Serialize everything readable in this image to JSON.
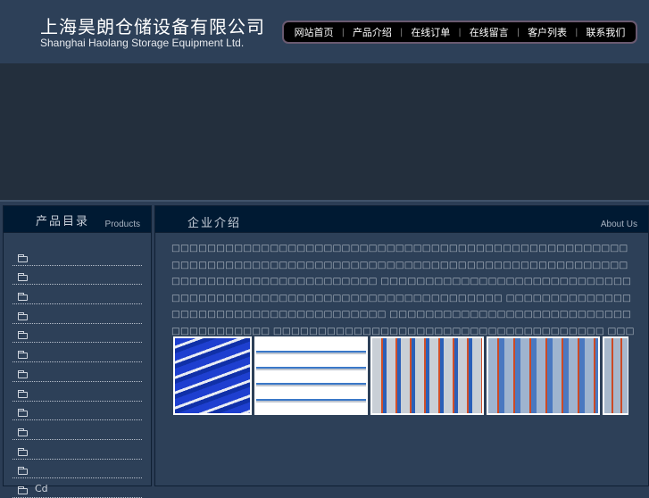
{
  "header": {
    "company_cn": "上海昊朗仓储设备有限公司",
    "company_en": "Shanghai Haolang Storage Equipment Ltd."
  },
  "nav": [
    "网站首页",
    "产品介绍",
    "在线订单",
    "在线留言",
    "客户列表",
    "联系我们"
  ],
  "nav_separator": "|",
  "sidebar": {
    "title": "产品目录",
    "subtitle": "Products",
    "items": [
      "",
      "",
      "",
      "",
      "",
      "",
      "",
      "",
      "",
      "",
      "",
      "",
      "Cd"
    ]
  },
  "main": {
    "title": "企业介绍",
    "subtitle": "About Us",
    "paragraph": "□□□□□□□□□□□□□□□□□□□□□□□□□□□□□□□□□□□□□□□□□□□□□□□□□□□□□□□□□□□□□□□□□□□□□□□□□□□□□□□□□□□□□□□□□□□□□□□□□□□□□□□□□□□□□□□□□□□□□□□□□□□□□ □□□□□□□□□□□□□□□□□□□□□□□□□□□□□□□□□□□□□□□□□□□□□□□□□□□□□□□□□□□□□□□□□ □□□□□□□□□□□□□□□□□□□□□□□□□□□□□□□□□□□□□□ □□□□□□□□□□□□□□□□□□□□□□□□□□□□□□□□□□□□□□ □□□□□□□□□□□□□□□□□□□□□□□□□□□□□□□□□□□□□ □□□□□□□□□□□□□□□□□□□□□□□□□□□□□□□□“□□□□□□□□□”□□□-□□□□□□□□□ □□□□□□□□□□□□□□□□□□□□□□□□□□□□□□□□□□□□□□□□□□ □□□□□□□□□□□□□□□!",
    "images": [
      "shelving-blue-bins",
      "blue-light-shelving",
      "warehouse-pallet-racking",
      "warehouse-racking-2",
      "warehouse-racking-3"
    ]
  }
}
